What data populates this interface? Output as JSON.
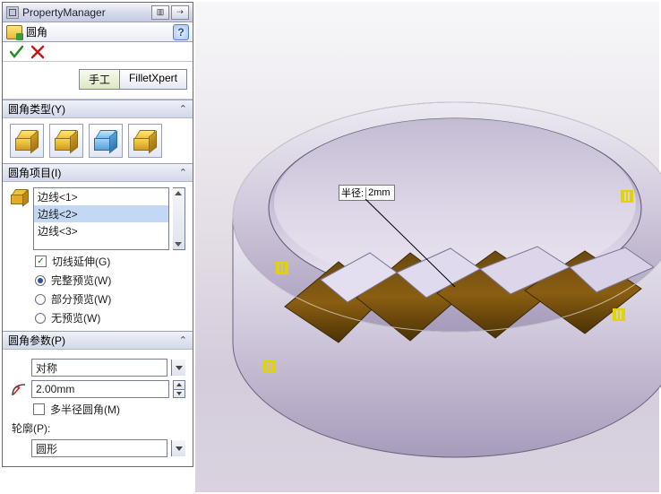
{
  "panel": {
    "title": "PropertyManager",
    "feature_name": "圆角",
    "mode": {
      "manual": "手工",
      "xpert": "FilletXpert"
    },
    "sections": {
      "type": {
        "title": "圆角类型(Y)"
      },
      "items": {
        "title": "圆角项目(I)",
        "edges": [
          "边线<1>",
          "边线<2>",
          "边线<3>"
        ],
        "tangent": "切线延伸(G)",
        "full_preview": "完整预览(W)",
        "partial_preview": "部分预览(W)",
        "no_preview": "无预览(W)"
      },
      "params": {
        "title": "圆角参数(P)",
        "symmetry": "对称",
        "radius": "2.00mm",
        "multi": "多半径圆角(M)",
        "profile_label": "轮廓(P):",
        "profile": "圆形"
      }
    }
  },
  "viewport": {
    "callout_label": "半径:",
    "callout_value": "2mm"
  }
}
